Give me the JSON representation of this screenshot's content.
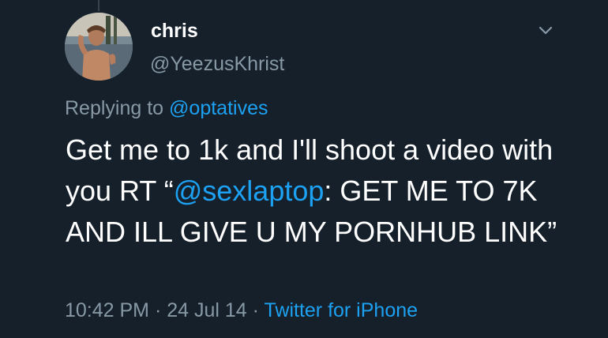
{
  "author": {
    "display_name": "chris",
    "handle": "@YeezusKhrist"
  },
  "reply": {
    "prefix": "Replying to",
    "target": "@optatives"
  },
  "tweet": {
    "text_before": "Get me to 1k and I'll shoot a video with you RT “",
    "mention": "@sexlaptop",
    "text_after": ": GET ME TO 7K AND ILL GIVE U MY PORNHUB LINK”"
  },
  "meta": {
    "time": "10:42 PM",
    "date": "24 Jul 14",
    "separator": "·",
    "source": "Twitter for iPhone"
  },
  "icons": {
    "menu": "chevron-down-icon",
    "avatar": "profile-photo"
  },
  "colors": {
    "background": "#15202b",
    "link": "#1da1f2",
    "secondary_text": "#8899a6",
    "primary_text": "#ffffff"
  }
}
